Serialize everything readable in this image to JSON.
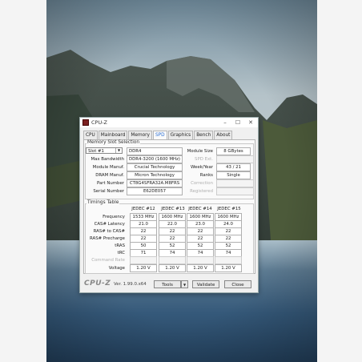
{
  "window": {
    "title": "CPU-Z"
  },
  "tabs": [
    "CPU",
    "Mainboard",
    "Memory",
    "SPD",
    "Graphics",
    "Bench",
    "About"
  ],
  "active_tab": "SPD",
  "slot_section": {
    "title": "Memory Slot Selection",
    "slot": "Slot #1",
    "type": "DDR4",
    "module_size_label": "Module Size",
    "module_size": "8 GBytes",
    "max_bandwidth_label": "Max Bandwidth",
    "max_bandwidth": "DDR4-3200 (1600 MHz)",
    "spd_ext_label": "SPD Ext.",
    "spd_ext": "",
    "module_manuf_label": "Module Manuf.",
    "module_manuf": "Crucial Technology",
    "week_year_label": "Week/Year",
    "week_year": "43 / 21",
    "dram_manuf_label": "DRAM Manuf.",
    "dram_manuf": "Micron Technology",
    "ranks_label": "Ranks",
    "ranks": "Single",
    "part_number_label": "Part Number",
    "part_number": "CT8G4SFRA32A.M8FRS",
    "correction_label": "Correction",
    "correction": "",
    "serial_number_label": "Serial Number",
    "serial_number": "E62DE057",
    "registered_label": "Registered",
    "registered": ""
  },
  "timings": {
    "title": "Timings Table",
    "columns": [
      "JEDEC #12",
      "JEDEC #13",
      "JEDEC #14",
      "JEDEC #15"
    ],
    "rows": [
      {
        "label": "Frequency",
        "values": [
          "1533 MHz",
          "1600 MHz",
          "1600 MHz",
          "1600 MHz"
        ]
      },
      {
        "label": "CAS# Latency",
        "values": [
          "21.0",
          "22.0",
          "23.0",
          "24.0"
        ]
      },
      {
        "label": "RAS# to CAS#",
        "values": [
          "22",
          "22",
          "22",
          "22"
        ]
      },
      {
        "label": "RAS# Precharge",
        "values": [
          "22",
          "22",
          "22",
          "22"
        ]
      },
      {
        "label": "tRAS",
        "values": [
          "50",
          "52",
          "52",
          "52"
        ]
      },
      {
        "label": "tRC",
        "values": [
          "71",
          "74",
          "74",
          "74"
        ]
      },
      {
        "label": "Command Rate",
        "values": [
          "",
          "",
          "",
          ""
        ]
      },
      {
        "label": "Voltage",
        "values": [
          "1.20 V",
          "1.20 V",
          "1.20 V",
          "1.20 V"
        ]
      }
    ]
  },
  "footer": {
    "brand": "CPU-Z",
    "version": "Ver. 1.99.0.x64",
    "tools_label": "Tools",
    "validate_label": "Validate",
    "close_label": "Close"
  }
}
